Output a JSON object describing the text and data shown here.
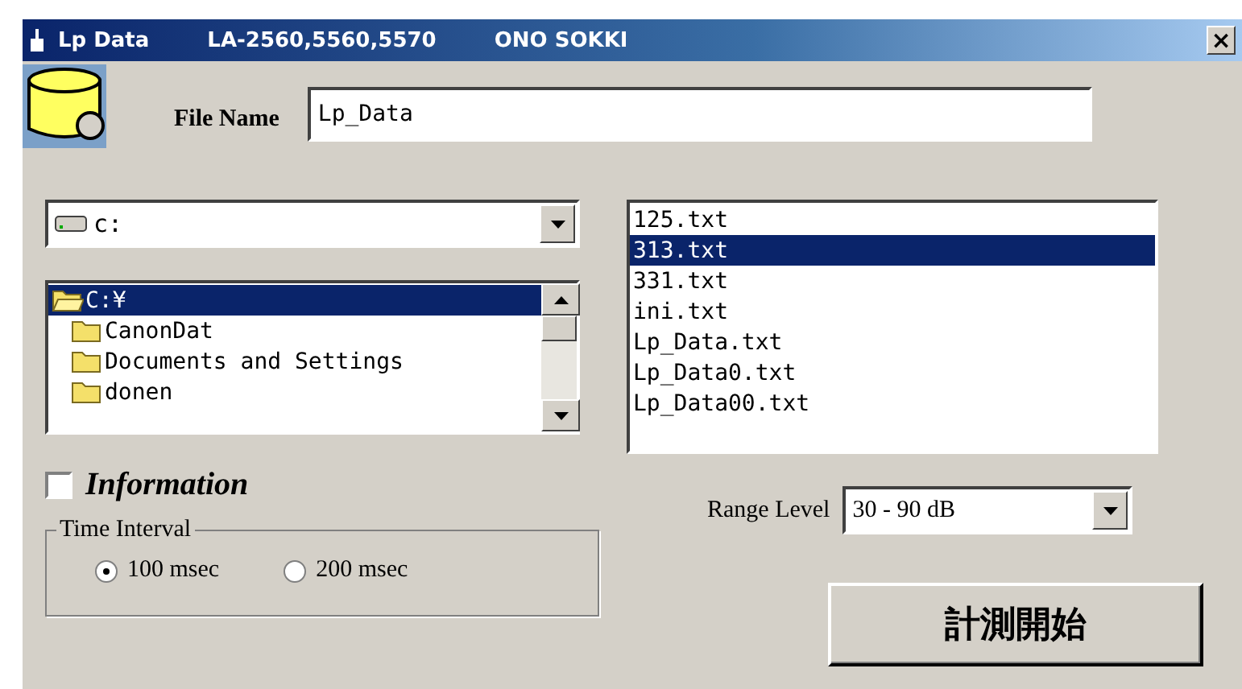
{
  "window": {
    "title_parts": [
      "Lp Data",
      "LA-2560,5560,5570",
      "ONO SOKKI"
    ],
    "close": "×"
  },
  "file_name": {
    "label": "File Name",
    "value": "Lp_Data"
  },
  "drive": {
    "value": "c:"
  },
  "folders": [
    {
      "name": "C:¥",
      "selected": true,
      "open": true
    },
    {
      "name": "CanonDat",
      "selected": false,
      "open": false
    },
    {
      "name": "Documents and Settings",
      "selected": false,
      "open": false
    },
    {
      "name": "donen",
      "selected": false,
      "open": false
    }
  ],
  "files": [
    {
      "name": "125.txt",
      "selected": false
    },
    {
      "name": "313.txt",
      "selected": true
    },
    {
      "name": "331.txt",
      "selected": false
    },
    {
      "name": "ini.txt",
      "selected": false
    },
    {
      "name": "Lp_Data.txt",
      "selected": false
    },
    {
      "name": "Lp_Data0.txt",
      "selected": false
    },
    {
      "name": "Lp_Data00.txt",
      "selected": false
    }
  ],
  "information": {
    "label": "Information",
    "checked": false
  },
  "time_interval": {
    "title": "Time Interval",
    "options": [
      {
        "label": "100 msec",
        "selected": true
      },
      {
        "label": "200 msec",
        "selected": false
      }
    ]
  },
  "range_level": {
    "label": "Range Level",
    "value": "30 - 90 dB"
  },
  "start_button": "計測開始"
}
